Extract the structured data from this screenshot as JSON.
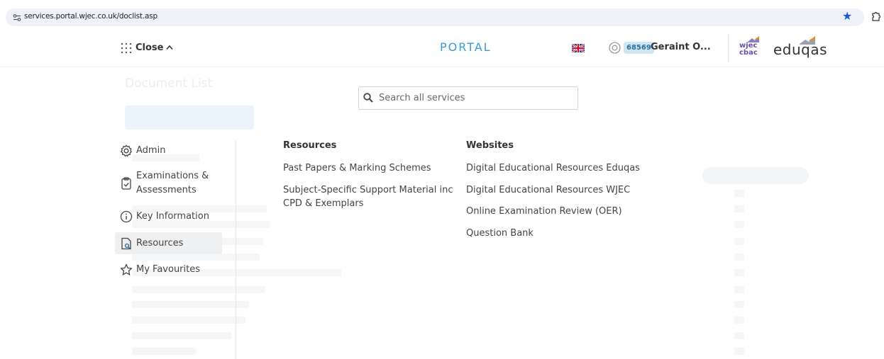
{
  "browser": {
    "url": "services.portal.wjec.co.uk/doclist.asp"
  },
  "header": {
    "menu_toggle_label": "Close",
    "portal_title": "PORTAL",
    "user_id": "68569",
    "user_name": "Geraint O...",
    "logo_wjec_line1": "wjec",
    "logo_wjec_line2": "cbac",
    "logo_eduqas": "eduqas"
  },
  "search": {
    "placeholder": "Search all services"
  },
  "sidebar": {
    "items": [
      {
        "label": "Admin",
        "icon": "gear-icon"
      },
      {
        "label_line1": "Examinations &",
        "label_line2": "Assessments",
        "icon": "clipboard-check-icon"
      },
      {
        "label": "Key Information",
        "icon": "info-icon"
      },
      {
        "label": "Resources",
        "icon": "document-search-icon",
        "active": true
      },
      {
        "label": "My Favourites",
        "icon": "star-icon"
      }
    ]
  },
  "resources": {
    "heading": "Resources",
    "links": [
      "Past Papers & Marking Schemes",
      "Subject-Specific Support Material inc",
      "CPD & Exemplars"
    ]
  },
  "websites": {
    "heading": "Websites",
    "links": [
      "Digital Educational Resources Eduqas",
      "Digital Educational Resources WJEC",
      "Online Examination Review (OER)",
      "Question Bank"
    ]
  },
  "background": {
    "title": "Document List"
  },
  "colors": {
    "accent": "#3a9bd4",
    "badge_bg": "#cfe6f5",
    "active_item_bg": "#eeeff1"
  }
}
